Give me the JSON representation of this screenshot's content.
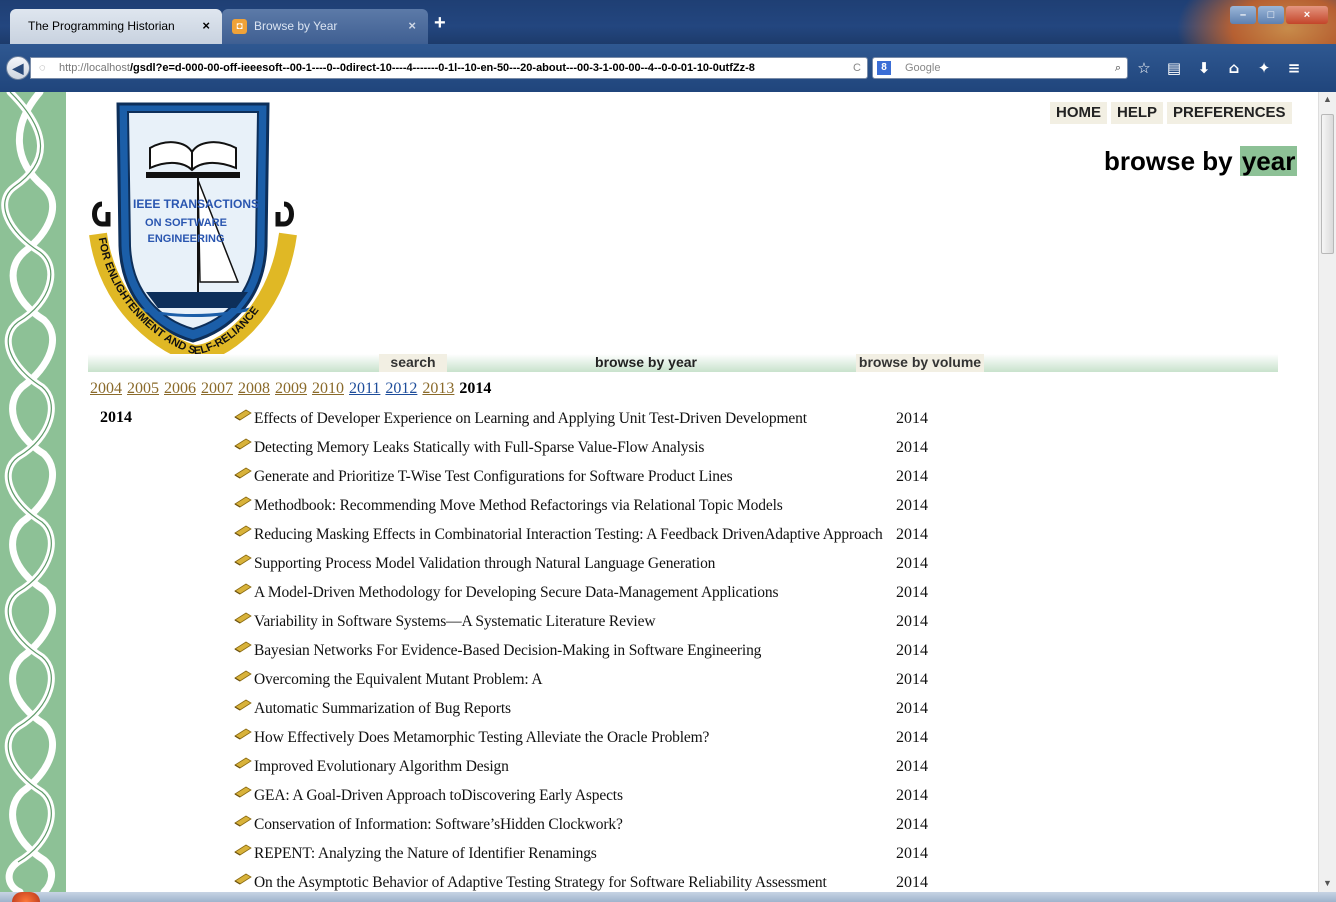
{
  "browser": {
    "tabs": [
      {
        "label": "The Programming Historian",
        "close": "×"
      },
      {
        "label": "Browse by Year",
        "close": "×"
      }
    ],
    "new_tab": "+",
    "url_host": "http://localhost",
    "url_rest": "/gsdl?e=d-000-00-off-ieeesoft--00-1----0--0direct-10----4-------0-1l--10-en-50---20-about---00-3-1-00-00--4--0-0-01-10-0utfZz-8",
    "search_engine_label": "Google",
    "window_controls": [
      "–",
      "□",
      "×"
    ]
  },
  "logo": {
    "line1": "IEEE TRANSACTIONS",
    "line2": "ON SOFTWARE",
    "line3": "ENGINEERING",
    "motto": "FOR ENLIGHTENMENT AND SELF-RELIANCE"
  },
  "top_menu": [
    "HOME",
    "HELP",
    "PREFERENCES"
  ],
  "heading": {
    "prefix": "browse by ",
    "highlight": "year"
  },
  "nav": {
    "search": "search",
    "browse_year": "browse by year",
    "browse_volume": "browse by volume"
  },
  "years": [
    "2004",
    "2005",
    "2006",
    "2007",
    "2008",
    "2009",
    "2010",
    "2011",
    "2012",
    "2013",
    "2014"
  ],
  "current_year": "2014",
  "group_label": "2014",
  "results": [
    {
      "title": "Effects of Developer Experience on Learning and Applying Unit Test-Driven Development",
      "year": "2014"
    },
    {
      "title": "Detecting Memory Leaks Statically with Full-Sparse Value-Flow Analysis",
      "year": "2014"
    },
    {
      "title": "Generate and Prioritize T-Wise Test Configurations for Software Product Lines",
      "year": "2014"
    },
    {
      "title": "Methodbook: Recommending Move Method Refactorings via Relational Topic Models",
      "year": "2014"
    },
    {
      "title": "Reducing Masking Effects in Combinatorial Interaction Testing: A Feedback DrivenAdaptive Approach",
      "year": "2014"
    },
    {
      "title": "Supporting Process Model Validation through Natural Language Generation",
      "year": "2014"
    },
    {
      "title": "A Model-Driven Methodology for Developing Secure Data-Management Applications",
      "year": "2014"
    },
    {
      "title": "Variability in Software Systems—A Systematic Literature Review",
      "year": "2014"
    },
    {
      "title": "Bayesian Networks For Evidence-Based Decision-Making in Software Engineering",
      "year": "2014"
    },
    {
      "title": "Overcoming the Equivalent Mutant Problem: A",
      "year": "2014"
    },
    {
      "title": "Automatic Summarization of Bug Reports",
      "year": "2014"
    },
    {
      "title": "How Effectively Does Metamorphic Testing Alleviate the Oracle Problem?",
      "year": "2014"
    },
    {
      "title": "Improved Evolutionary Algorithm Design",
      "year": "2014"
    },
    {
      "title": "GEA: A Goal-Driven Approach toDiscovering Early Aspects",
      "year": "2014"
    },
    {
      "title": "Conservation of Information: Software’sHidden Clockwork?",
      "year": "2014"
    },
    {
      "title": "REPENT: Analyzing the Nature of Identifier Renamings",
      "year": "2014"
    },
    {
      "title": "On the Asymptotic Behavior of Adaptive Testing Strategy for Software Reliability Assessment",
      "year": "2014"
    }
  ],
  "colors": {
    "accent_green": "#8dc196",
    "menu_bg": "#f2efe3",
    "browser_blue": "#23467f"
  }
}
